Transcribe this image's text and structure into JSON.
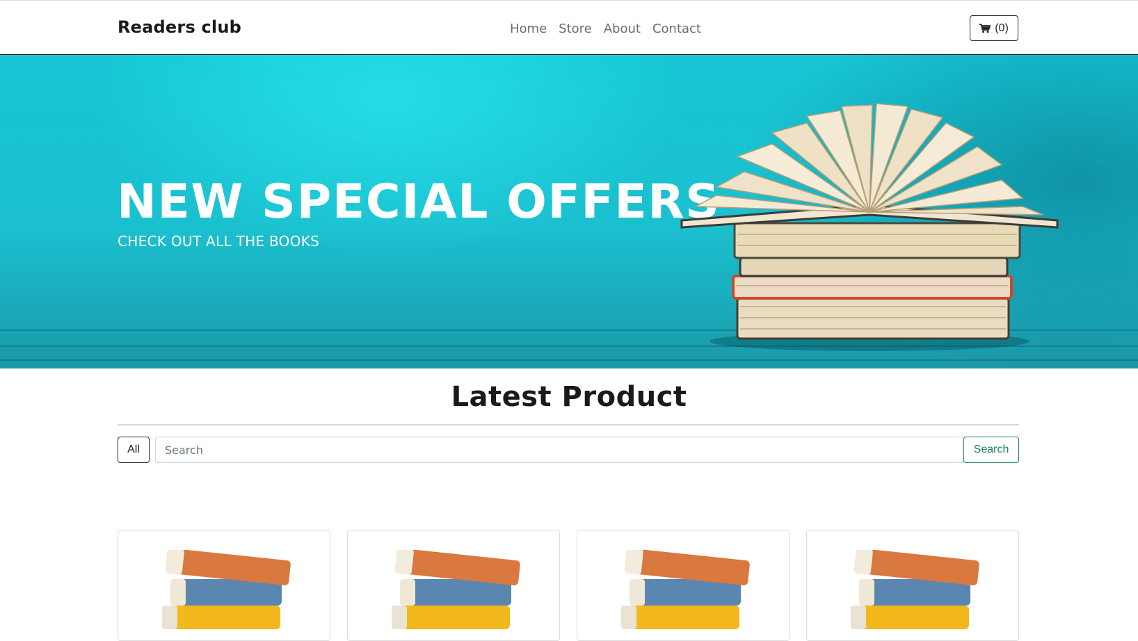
{
  "navbar": {
    "brand": "Readers club",
    "links": [
      {
        "label": "Home"
      },
      {
        "label": "Store"
      },
      {
        "label": "About"
      },
      {
        "label": "Contact"
      }
    ],
    "cart": {
      "icon": "cart-icon",
      "label": "(0)"
    }
  },
  "hero": {
    "title": "NEW SPECIAL OFFERS",
    "subtitle": "CHECK OUT ALL THE BOOKS",
    "image": "stacked-open-book-illustration"
  },
  "products_section": {
    "title": "Latest Product",
    "filter_all_label": "All",
    "search_placeholder": "Search",
    "search_button_label": "Search"
  },
  "products": [
    {
      "image": "book-stack-image"
    },
    {
      "image": "book-stack-image"
    },
    {
      "image": "book-stack-image"
    },
    {
      "image": "book-stack-image"
    }
  ],
  "colors": {
    "accent_green": "#198754",
    "hero_teal": "#1bc0cf",
    "text_dark": "#212529"
  }
}
